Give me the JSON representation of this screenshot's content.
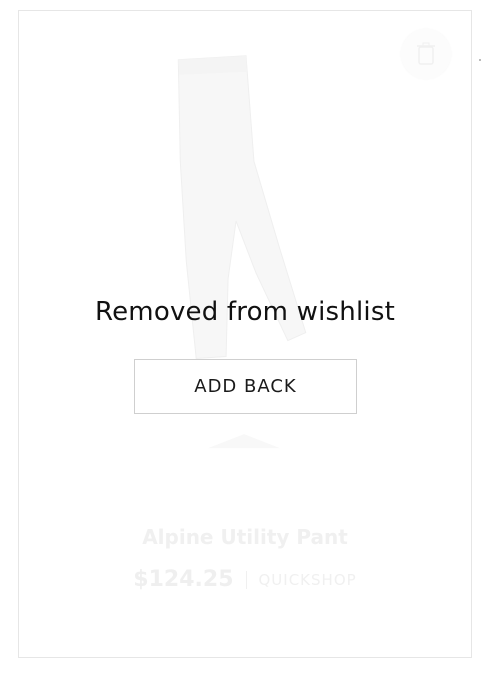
{
  "card": {
    "message": "Removed from wishlist",
    "add_back_label": "ADD BACK",
    "product_name": "Alpine Utility Pant",
    "price": "$124.25",
    "quickshop_label": "QUICKSHOP",
    "trash_icon": "trash-icon"
  }
}
